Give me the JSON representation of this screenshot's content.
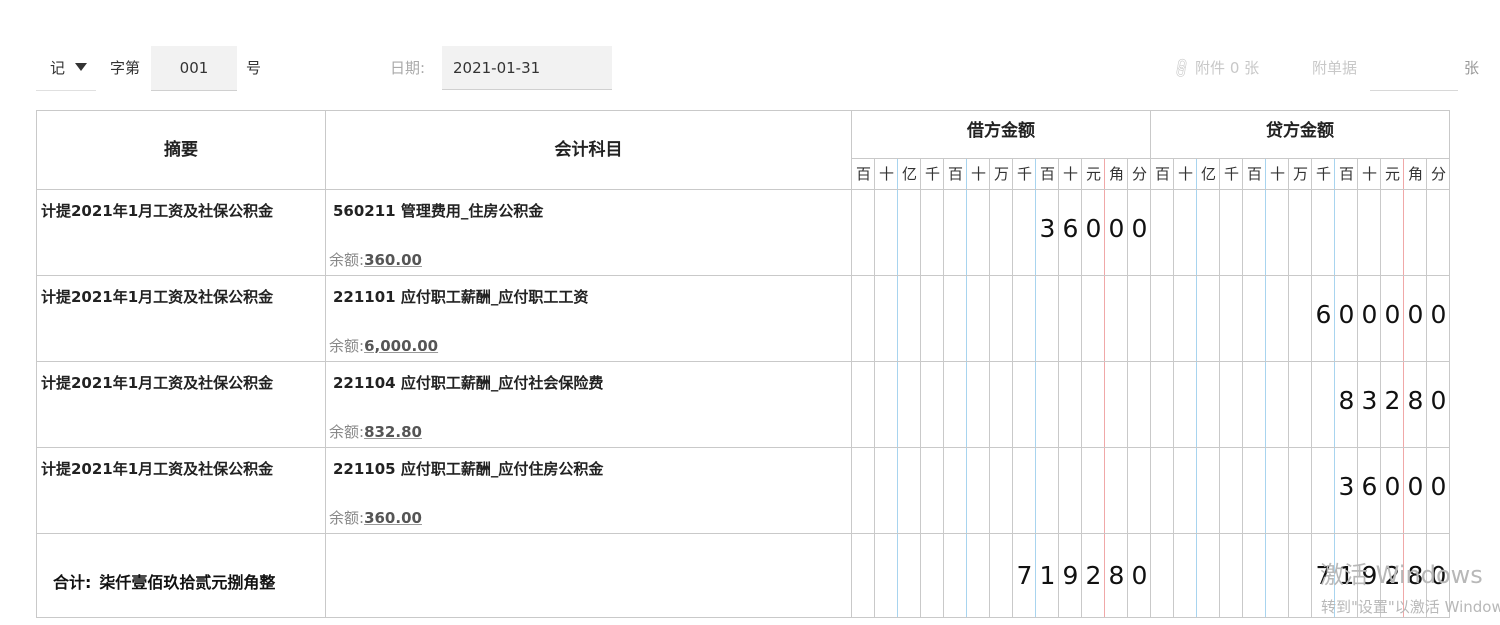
{
  "header": {
    "voucher_type": "记",
    "zi_label": "字第",
    "voucher_no": "001",
    "hao_label": "号",
    "date_label": "日期:",
    "date_value": "2021-01-31",
    "attachments_label": "附件 0 张",
    "fudan_label": "附单据",
    "fudan_value": "",
    "zhang_label": "张"
  },
  "table": {
    "col_summary": "摘要",
    "col_account": "会计科目",
    "col_debit": "借方金额",
    "col_credit": "贷方金额",
    "units": [
      "百",
      "十",
      "亿",
      "千",
      "百",
      "十",
      "万",
      "千",
      "百",
      "十",
      "元",
      "角",
      "分"
    ],
    "rows": [
      {
        "summary": "计提2021年1月工资及社保公积金",
        "account": "560211 管理费用_住房公积金",
        "balance_label": "余额:",
        "balance": "360.00",
        "debit": "36000",
        "credit": ""
      },
      {
        "summary": "计提2021年1月工资及社保公积金",
        "account": "221101 应付职工薪酬_应付职工工资",
        "balance_label": "余额:",
        "balance": "6,000.00",
        "debit": "",
        "credit": "600000"
      },
      {
        "summary": "计提2021年1月工资及社保公积金",
        "account": "221104 应付职工薪酬_应付社会保险费",
        "balance_label": "余额:",
        "balance": "832.80",
        "debit": "",
        "credit": "83280"
      },
      {
        "summary": "计提2021年1月工资及社保公积金",
        "account": "221105 应付职工薪酬_应付住房公积金",
        "balance_label": "余额:",
        "balance": "360.00",
        "debit": "",
        "credit": "36000"
      }
    ],
    "total_label": "合计:",
    "total_words": "柒仟壹佰玖拾贰元捌角整",
    "total_debit": "719280",
    "total_credit": "719280"
  },
  "watermark": {
    "line1": "激活 Windows",
    "line2": "转到\"设置\"以激活 Windows。"
  },
  "colors": {
    "grid": "#c9c9c9",
    "blue_separator": "#a8d4ef",
    "red_separator": "#f0a8a8"
  }
}
